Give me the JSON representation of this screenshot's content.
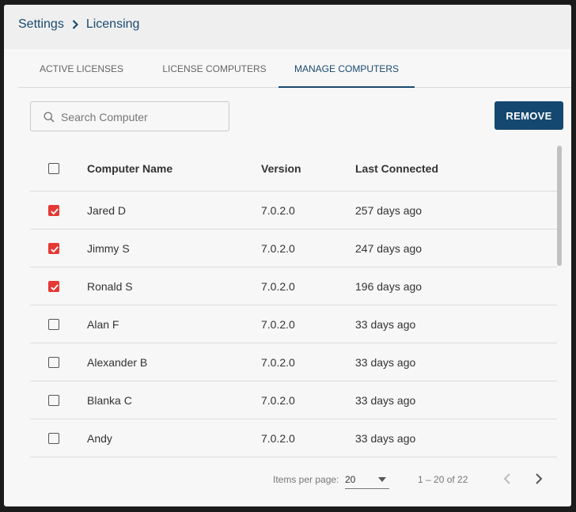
{
  "breadcrumb": {
    "parent": "Settings",
    "current": "Licensing"
  },
  "tabs": [
    {
      "label": "ACTIVE LICENSES"
    },
    {
      "label": "LICENSE COMPUTERS"
    },
    {
      "label": "MANAGE COMPUTERS",
      "active": true
    }
  ],
  "search": {
    "placeholder": "Search Computer",
    "value": ""
  },
  "actions": {
    "remove_label": "REMOVE"
  },
  "table": {
    "columns": {
      "name": "Computer Name",
      "version": "Version",
      "last": "Last Connected"
    },
    "rows": [
      {
        "name": "Jared D",
        "version": "7.0.2.0",
        "last": "257 days ago",
        "checked": true
      },
      {
        "name": "Jimmy S",
        "version": "7.0.2.0",
        "last": "247 days ago",
        "checked": true
      },
      {
        "name": "Ronald S",
        "version": "7.0.2.0",
        "last": "196 days ago",
        "checked": true
      },
      {
        "name": "Alan F",
        "version": "7.0.2.0",
        "last": "33 days ago",
        "checked": false
      },
      {
        "name": "Alexander B",
        "version": "7.0.2.0",
        "last": "33 days ago",
        "checked": false
      },
      {
        "name": "Blanka C",
        "version": "7.0.2.0",
        "last": "33 days ago",
        "checked": false
      },
      {
        "name": "Andy",
        "version": "7.0.2.0",
        "last": "33 days ago",
        "checked": false
      }
    ]
  },
  "paginator": {
    "items_label": "Items per page:",
    "page_size": "20",
    "range": "1 – 20 of 22"
  },
  "colors": {
    "accent": "#1b4a70",
    "button": "#144870",
    "checkbox_checked": "#e53935"
  }
}
